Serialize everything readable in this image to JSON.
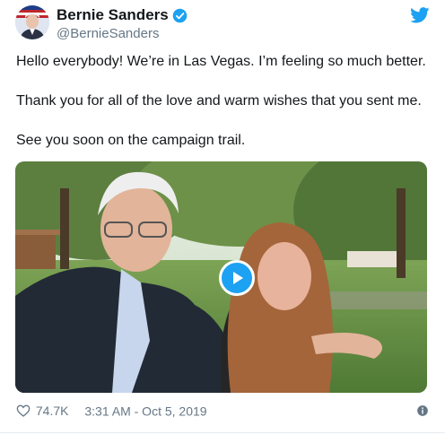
{
  "author": {
    "display_name": "Bernie Sanders",
    "handle": "@BernieSanders",
    "verified": true
  },
  "tweet": {
    "paragraphs": [
      "Hello everybody! We’re in Las Vegas. I’m feeling so much better.",
      "Thank you for all of the love and warm wishes that you sent me.",
      "See you soon on the campaign trail."
    ]
  },
  "media": {
    "type": "video",
    "play_icon": "play-icon"
  },
  "footer": {
    "likes": "74.7K",
    "timestamp": "3:31 AM - Oct 5, 2019",
    "heart_icon": "heart-icon",
    "info_icon": "info-icon"
  },
  "colors": {
    "accent": "#1da1f2",
    "text": "#14171a",
    "muted": "#657786"
  }
}
